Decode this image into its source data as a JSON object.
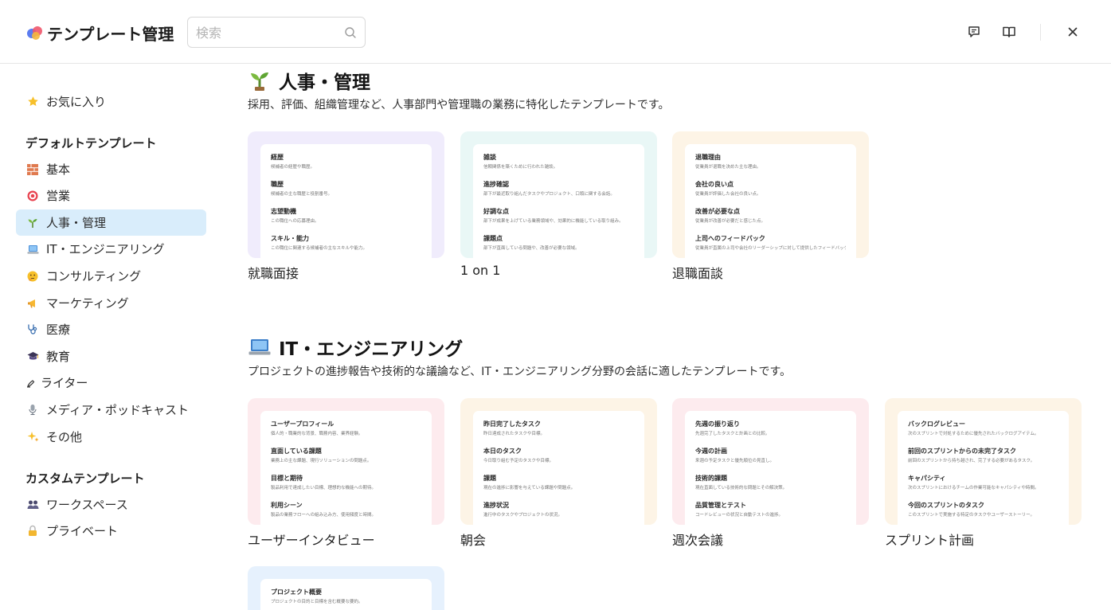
{
  "header": {
    "title": "テンプレート管理",
    "search_placeholder": "検索",
    "icons": {
      "logo": "app-logo-icon",
      "feedback": "feedback-icon",
      "docs": "book-icon",
      "close": "close-icon"
    }
  },
  "sidebar": {
    "favorites": {
      "label": "お気に入り",
      "icon": "star-icon"
    },
    "default_heading": "デフォルトテンプレート",
    "default_items": [
      {
        "label": "基本",
        "icon": "bricks-icon"
      },
      {
        "label": "営業",
        "icon": "target-icon"
      },
      {
        "label": "人事・管理",
        "icon": "seedling-icon"
      },
      {
        "label": "IT・エンジニアリング",
        "icon": "laptop-icon"
      },
      {
        "label": "コンサルティング",
        "icon": "thinking-face-icon"
      },
      {
        "label": "マーケティング",
        "icon": "megaphone-icon"
      },
      {
        "label": "医療",
        "icon": "stethoscope-icon"
      },
      {
        "label": "教育",
        "icon": "graduation-cap-icon"
      },
      {
        "label": "ライター",
        "icon": "writing-hand-icon"
      },
      {
        "label": "メディア・ポッドキャスト",
        "icon": "microphone-icon"
      },
      {
        "label": "その他",
        "icon": "sparkles-icon"
      }
    ],
    "custom_heading": "カスタムテンプレート",
    "custom_items": [
      {
        "label": "ワークスペース",
        "icon": "people-icon"
      },
      {
        "label": "プライベート",
        "icon": "lock-icon"
      }
    ]
  },
  "sections": [
    {
      "title": "人事・管理",
      "icon": "seedling-icon",
      "description": "採用、評価、組織管理など、人事部門や管理職の業務に特化したテンプレートです。",
      "cards": [
        {
          "label": "就職面接",
          "tint": "#f0ecfc",
          "preview": [
            {
              "title": "経歴",
              "text": "候補者の経歴や職歴。"
            },
            {
              "title": "職歴",
              "text": "候補者の主な職歴と役割番号。"
            },
            {
              "title": "志望動機",
              "text": "この職位への応募理由。"
            },
            {
              "title": "スキル・能力",
              "text": "この職位に関連する候補者の主なスキルや能力。"
            }
          ]
        },
        {
          "label": "1 on 1",
          "tint": "#e9f7f6",
          "preview": [
            {
              "title": "雑談",
              "text": "信頼関係を築くために行われた雑談。"
            },
            {
              "title": "進捗確認",
              "text": "部下が最近取り組んだタスクやプロジェクト、口頭に関する会話。"
            },
            {
              "title": "好調な点",
              "text": "部下が成果を上げている業務領域や、効果的に機能している取り組み。"
            },
            {
              "title": "課題点",
              "text": "部下が直面している問題や、改善が必要な領域。"
            }
          ]
        },
        {
          "label": "退職面談",
          "tint": "#fdf4e6",
          "preview": [
            {
              "title": "退職理由",
              "text": "従業員が退職を決めた主な理由。"
            },
            {
              "title": "会社の良い点",
              "text": "従業員が評価した会社の良い点。"
            },
            {
              "title": "改善が必要な点",
              "text": "従業員が改善が必要だと感じた点。"
            },
            {
              "title": "上司へのフィードバック",
              "text": "従業員が直属の上司や会社のリーダーシップに対して提供したフィードバック。"
            }
          ]
        }
      ]
    },
    {
      "title": "IT・エンジニアリング",
      "icon": "laptop-icon",
      "description": "プロジェクトの進捗報告や技術的な議論など、IT・エンジニアリング分野の会話に適したテンプレートです。",
      "cards": [
        {
          "label": "ユーザーインタビュー",
          "tint": "#fdebee",
          "preview": [
            {
              "title": "ユーザープロフィール",
              "text": "個人的・職業的な背景、職務内容、業界経験。"
            },
            {
              "title": "直面している課題",
              "text": "業務上の主な課題、現行ソリューションの問題点。"
            },
            {
              "title": "目標と期待",
              "text": "製品利用で達成したい目標、理想的な機能への期待。"
            },
            {
              "title": "利用シーン",
              "text": "製品の業務フローへの組み込み方、使用頻度と時間。"
            }
          ]
        },
        {
          "label": "朝会",
          "tint": "#fdf4e6",
          "preview": [
            {
              "title": "昨日完了したタスク",
              "text": "昨日達成されたタスクや目標。"
            },
            {
              "title": "本日のタスク",
              "text": "今日取り組む予定のタスクや目標。"
            },
            {
              "title": "課題",
              "text": "現在の進捗に影響を与えている課題や問題点。"
            },
            {
              "title": "進捗状況",
              "text": "進行中のタスクやプロジェクトの状況。"
            }
          ]
        },
        {
          "label": "週次会議",
          "tint": "#fdebee",
          "preview": [
            {
              "title": "先週の振り返り",
              "text": "先週完了したタスクと計画との比較。"
            },
            {
              "title": "今週の計画",
              "text": "来週の予定タスクと優先順位の見直し。"
            },
            {
              "title": "技術的課題",
              "text": "現在直面している技術的な問題とその解決策。"
            },
            {
              "title": "品質管理とテスト",
              "text": "コードレビューの状況と自動テストの進捗。"
            }
          ]
        },
        {
          "label": "スプリント計画",
          "tint": "#fdf4e6",
          "preview": [
            {
              "title": "バックログレビュー",
              "text": "次のスプリントで対処するために優先されたバックログアイテム。"
            },
            {
              "title": "前回のスプリントからの未完了タスク",
              "text": "前回のスプリントから持ち越され、完了する必要があるタスク。"
            },
            {
              "title": "キャパシティ",
              "text": "次のスプリントにおけるチームの作業可能なキャパシティや時間。"
            },
            {
              "title": "今回のスプリントのタスク",
              "text": "このスプリントで実施する特定のタスクやユーザーストーリー。"
            }
          ]
        },
        {
          "label": "",
          "tint": "#e6f1fd",
          "preview": [
            {
              "title": "プロジェクト概要",
              "text": "プロジェクトの目的と目標を含む概要な要約。"
            }
          ]
        }
      ]
    }
  ]
}
